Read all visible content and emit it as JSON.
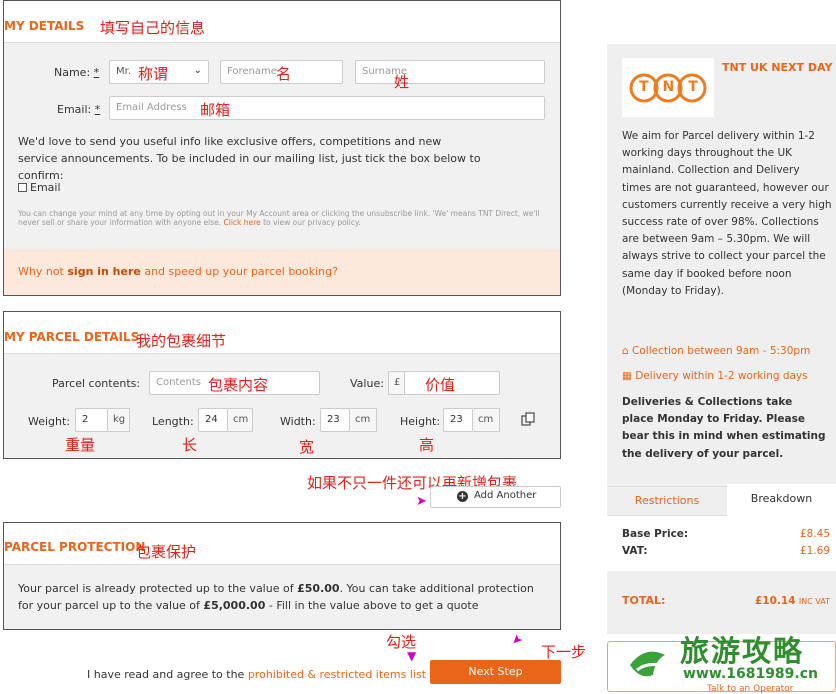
{
  "my_details": {
    "title": "MY DETAILS",
    "annotation": "填写自己的信息",
    "name_label": "Name:",
    "req": "*",
    "title_value": "Mr.",
    "title_ann": "称谓",
    "forename_placeholder": "Forename",
    "forename_ann": "名",
    "surname_placeholder": "Surname",
    "surname_ann": "姓",
    "email_label": "Email:",
    "email_placeholder": "Email Address",
    "email_ann": "邮箱",
    "info_text": "We'd love to send you useful info like exclusive offers, competitions and new service announcements. To be included in our mailing list, just tick the box below to confirm:",
    "email_checkbox": "Email",
    "fine_print": "You can change your mind at any time by opting out in your My Account area or clicking the unsubscribe link. 'We' means TNT Direct, we'll never sell or share your information with anyone else.",
    "click_here": "Click here",
    "fine_print_end": "to view our privacy policy.",
    "signin_pre": "Why not",
    "signin_link": "sign in here",
    "signin_post": "and speed up your parcel booking?"
  },
  "parcel_details": {
    "title": "MY PARCEL DETAILS",
    "annotation": "我的包裹细节",
    "contents_label": "Parcel contents:",
    "contents_placeholder": "Contents",
    "contents_ann": "包裹内容",
    "value_label": "Value:",
    "currency": "£",
    "value_ann": "价值",
    "weight_label": "Weight:",
    "weight_value": "2",
    "weight_unit": "kg",
    "weight_ann": "重量",
    "length_label": "Length:",
    "length_value": "24",
    "length_unit": "cm",
    "length_ann": "长",
    "width_label": "Width:",
    "width_value": "23",
    "width_unit": "cm",
    "width_ann": "宽",
    "height_label": "Height:",
    "height_value": "23",
    "height_unit": "cm",
    "height_ann": "高",
    "add_ann": "如果不只一件还可以再新增包裹",
    "add_another": "Add Another"
  },
  "protection": {
    "title": "PARCEL PROTECTION",
    "annotation": "包裹保护",
    "text_pre": "Your parcel is already protected up to the value of",
    "amount1": "£50.00",
    "text_mid": ". You can take additional protection for your parcel up to the value of",
    "amount2": "£5,000.00",
    "text_post": "- Fill in the value above to get a quote"
  },
  "footer": {
    "check_ann": "勾选",
    "next_ann": "下一步",
    "agree_pre": "I have read and agree to the",
    "agree_link": "prohibited & restricted items list",
    "next_step": "Next Step"
  },
  "sidebar": {
    "service": "TNT UK NEXT DAY",
    "logo_text": "TNT",
    "description": "We aim for Parcel delivery within 1-2 working days throughout the UK mainland. Collection and Delivery times are not guaranteed, however our customers currently receive a very high success rate of over 98%. Collections are between 9am – 5.30pm. We will always strive to collect your parcel the same day if booked before noon (Monday to Friday).",
    "collection": "Collection between 9am - 5:30pm",
    "delivery": "Delivery within 1-2 working days",
    "notice": "Deliveries & Collections take place Monday to Friday. Please bear this in mind when estimating the delivery of your parcel.",
    "tab_restrictions": "Restrictions",
    "tab_breakdown": "Breakdown",
    "base_label": "Base Price:",
    "base_value": "£8.45",
    "vat_label": "VAT:",
    "vat_value": "£1.69",
    "total_label": "TOTAL:",
    "total_value": "£10.14",
    "total_suffix": "INC VAT",
    "operator": "Talk to an Operator"
  },
  "watermark": {
    "title": "旅游攻略",
    "url": "www.1681989.cn"
  },
  "colors": {
    "accent": "#e8651a",
    "annotation": "#e0201b",
    "panel_bg": "#f1f1f1"
  }
}
